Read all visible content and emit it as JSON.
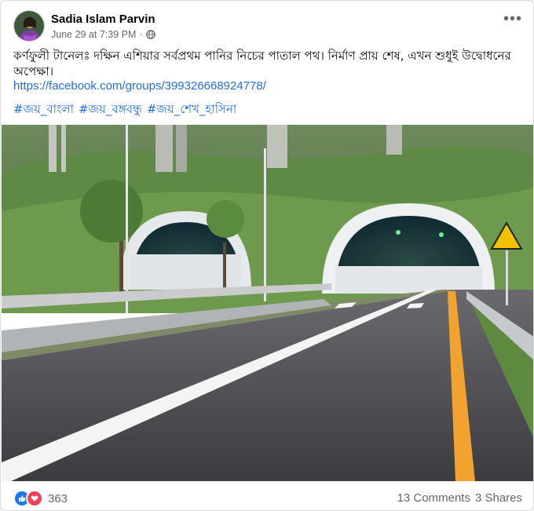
{
  "post": {
    "author": "Sadia Islam Parvin",
    "date": "June 29 at 7:39 PM",
    "separator": "·",
    "privacy_icon": "globe-icon",
    "more_icon": "more-horizontal-icon",
    "text": "কর্ণফুলী টানেলঃ দক্ষিন এশিয়ার সর্বপ্রথম পানির নিচের পাতাল পথ। নির্মাণ প্রায় শেষ, এখন শুধুই উদ্বোধনের অপেক্ষা।",
    "link": "https://facebook.com/groups/399326668924778/",
    "hashtags": [
      "#জয়_বাংলা",
      "#জয়_বঙ্গবন্ধু",
      "#জয়_শেখ_হাসিনা"
    ],
    "photo_icon": "tunnel-photo"
  },
  "footer": {
    "reaction_icons": [
      "like-icon",
      "love-icon"
    ],
    "reaction_count": "363",
    "comments": "13 Comments",
    "shares": "3 Shares"
  },
  "colors": {
    "link": "#216fdb",
    "like": "#1877f2",
    "love": "#f33e58",
    "secondary_text": "#65676b"
  }
}
